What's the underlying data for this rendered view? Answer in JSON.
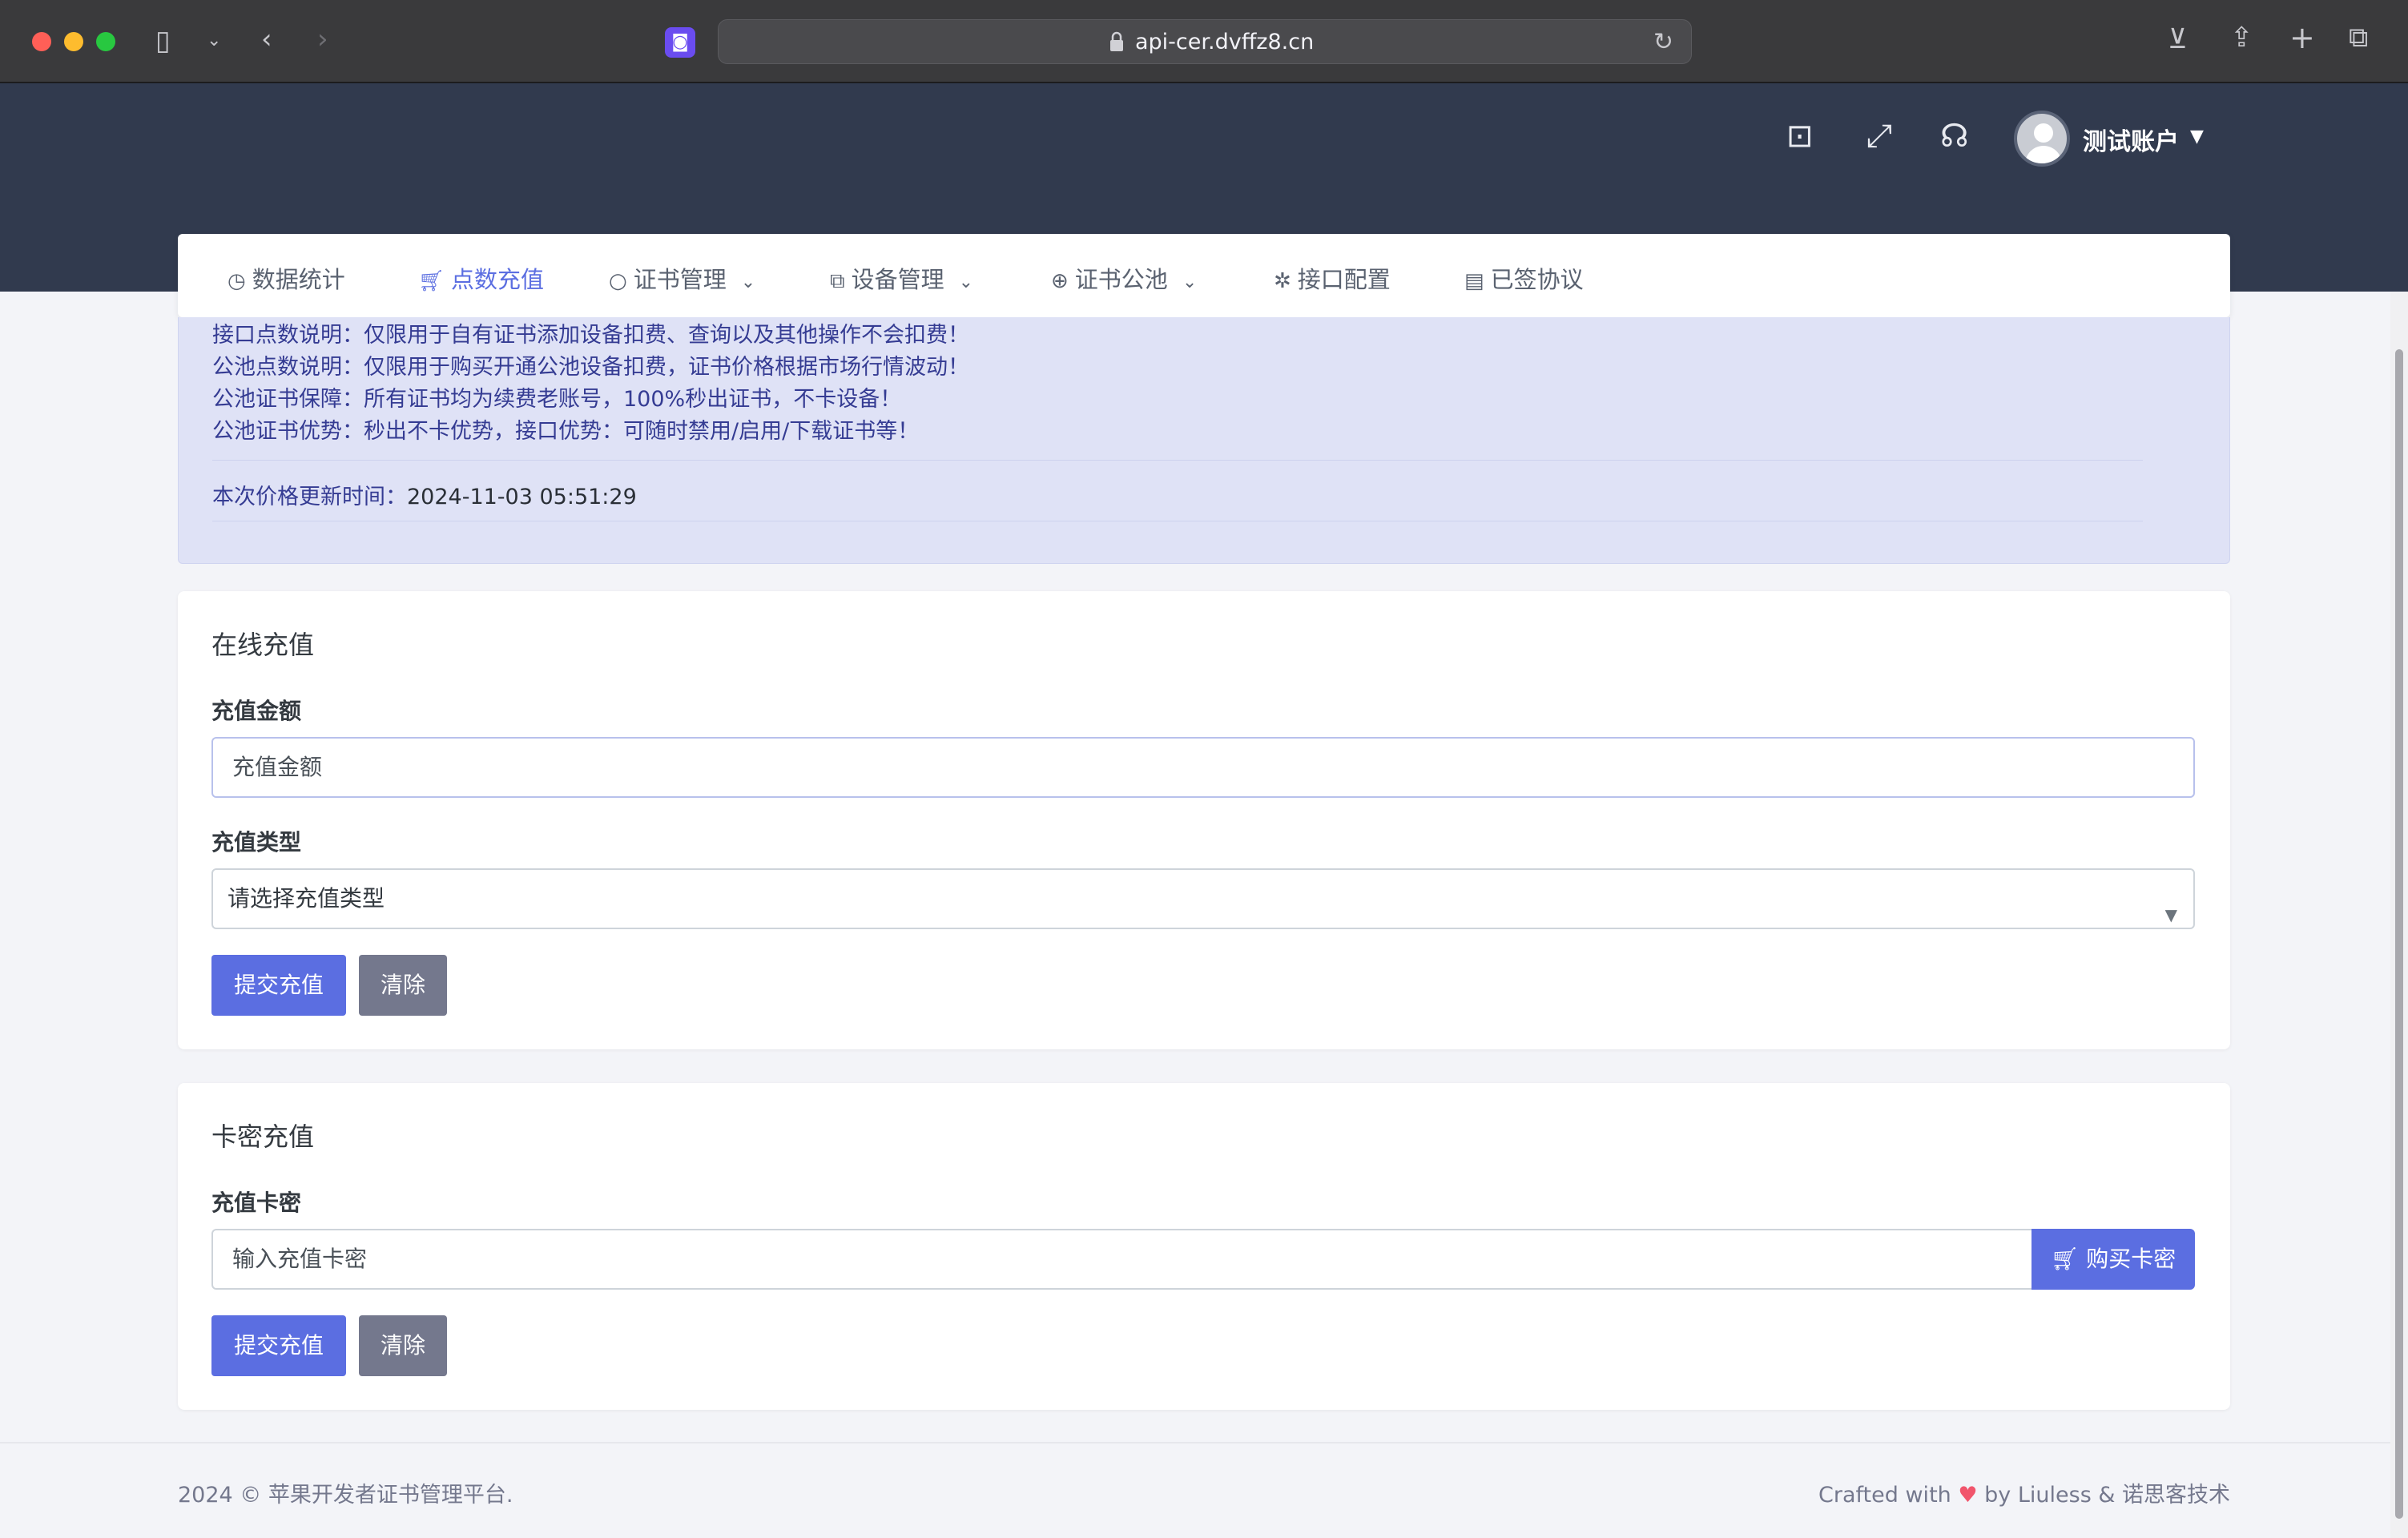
{
  "browser": {
    "url": "api-cer.dvffz8.cn"
  },
  "header": {
    "user_name": "测试账户"
  },
  "nav": {
    "items": [
      {
        "label": "数据统计",
        "icon": "clock-icon",
        "has_dropdown": false,
        "active": false
      },
      {
        "label": "点数充值",
        "icon": "cart-icon",
        "has_dropdown": false,
        "active": true
      },
      {
        "label": "证书管理",
        "icon": "circle-icon",
        "has_dropdown": true,
        "active": false
      },
      {
        "label": "设备管理",
        "icon": "copy-icon",
        "has_dropdown": true,
        "active": false
      },
      {
        "label": "证书公池",
        "icon": "plus-circle-icon",
        "has_dropdown": true,
        "active": false
      },
      {
        "label": "接口配置",
        "icon": "puzzle-icon",
        "has_dropdown": false,
        "active": false
      },
      {
        "label": "已签协议",
        "icon": "document-icon",
        "has_dropdown": false,
        "active": false
      }
    ]
  },
  "notice": {
    "lines": [
      "接口点数说明：仅限用于自有证书添加设备扣费、查询以及其他操作不会扣费！",
      "公池点数说明：仅限用于购买开通公池设备扣费，证书价格根据市场行情波动！",
      "公池证书保障：所有证书均为续费老账号，100%秒出证书，不卡设备！",
      "公池证书优势：秒出不卡优势，接口优势：可随时禁用/启用/下载证书等！"
    ],
    "update_label": "本次价格更新时间：",
    "update_time": "2024-11-03 05:51:29"
  },
  "online_recharge": {
    "title": "在线充值",
    "amount_label": "充值金额",
    "amount_placeholder": "充值金额",
    "type_label": "充值类型",
    "type_selected": "请选择充值类型",
    "submit_label": "提交充值",
    "clear_label": "清除"
  },
  "card_recharge": {
    "title": "卡密充值",
    "code_label": "充值卡密",
    "code_placeholder": "输入充值卡密",
    "buy_label": "购买卡密",
    "submit_label": "提交充值",
    "clear_label": "清除"
  },
  "footer": {
    "copyright": "2024 © 苹果开发者证书管理平台.",
    "crafted_prefix": "Crafted with",
    "crafted_suffix": "by Liuless & 诺思客技术"
  },
  "colors": {
    "primary": "#5b6ee1",
    "secondary": "#74788d",
    "topbar": "#313a4e",
    "notice_bg": "#dfe2f6",
    "notice_text": "#353c93"
  }
}
